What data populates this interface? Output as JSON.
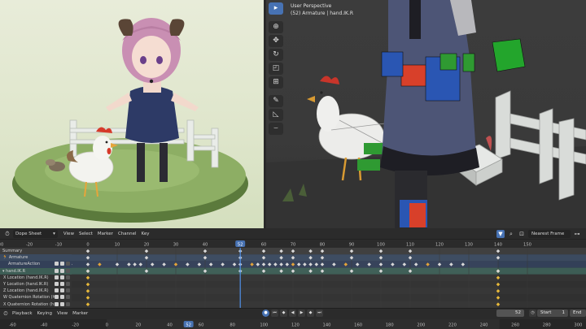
{
  "render_view": {
    "colors": {
      "ground": "#8dae64",
      "dress": "#2d3a66",
      "hair": "#c98fb3",
      "horns": "#5a4536",
      "fence": "#e9ece8"
    }
  },
  "viewport": {
    "title_line1": "User Perspective",
    "title_line2": "(52) Armature | hand.IK.R",
    "tools": [
      {
        "name": "select-box",
        "glyph": "▸",
        "active": true
      },
      {
        "name": "cursor",
        "glyph": "⊕",
        "active": false
      },
      {
        "name": "move",
        "glyph": "✥",
        "active": false
      },
      {
        "name": "rotate",
        "glyph": "↻",
        "active": false
      },
      {
        "name": "scale",
        "glyph": "◰",
        "active": false
      },
      {
        "name": "transform",
        "glyph": "⊞",
        "active": false
      },
      {
        "name": "annotate",
        "glyph": "✎",
        "active": false
      },
      {
        "name": "measure",
        "glyph": "◺",
        "active": false
      },
      {
        "name": "pose-tool",
        "glyph": "⌣",
        "active": false
      }
    ]
  },
  "dope_sheet": {
    "editor_label": "Dope Sheet",
    "menu": [
      "View",
      "Select",
      "Marker",
      "Channel",
      "Key"
    ],
    "interpolation": "Nearest Frame",
    "ruler_labels": [
      "-10",
      "0",
      "10",
      "20",
      "30",
      "40",
      "52",
      "60",
      "70",
      "80",
      "90",
      "100",
      "110",
      "120",
      "130",
      "140",
      "150"
    ],
    "ruler_start": -30,
    "ruler_end": 170,
    "extra_left_labels": [
      "-30",
      "-20"
    ],
    "current_frame": 52,
    "channels": [
      {
        "kind": "summary",
        "label": "Summary"
      },
      {
        "kind": "object",
        "label": "Armature"
      },
      {
        "kind": "action",
        "label": "ArmatureAction"
      },
      {
        "kind": "group",
        "label": "hand.IK.R"
      },
      {
        "kind": "fcurve",
        "label": "X Location (hand.IK.R)"
      },
      {
        "kind": "fcurve",
        "label": "Y Location (hand.IK.R)"
      },
      {
        "kind": "fcurve",
        "label": "Z Location (hand.IK.R)"
      },
      {
        "kind": "fcurve",
        "label": "W Quaternion Rotation (h"
      },
      {
        "kind": "fcurve",
        "label": "X Quaternion Rotation (h"
      }
    ],
    "keyframes_group": [
      0,
      140
    ],
    "keyframes_dense": [
      -10,
      -6,
      0,
      4,
      10,
      14,
      16,
      18,
      22,
      26,
      30,
      34,
      38,
      42,
      46,
      50,
      52,
      56,
      58,
      60,
      62,
      64,
      66,
      68,
      70,
      72,
      74,
      76,
      78,
      80,
      84,
      88,
      92,
      96,
      100,
      104,
      108,
      112,
      116,
      120,
      124,
      128
    ],
    "keyframes_sparse": [
      0,
      20,
      40,
      52,
      60,
      66,
      70,
      76,
      80,
      90,
      100,
      110,
      140
    ]
  },
  "timeline": {
    "menu": [
      "Playback",
      "Keying",
      "View",
      "Marker"
    ],
    "current_frame": "52",
    "start_label": "Start",
    "start_value": "1",
    "end_label": "End",
    "ruler_labels": [
      "-60",
      "-40",
      "-20",
      "0",
      "20",
      "40",
      "52",
      "60",
      "80",
      "100",
      "120",
      "140",
      "160",
      "180",
      "200",
      "220",
      "240",
      "260",
      "280",
      "300"
    ],
    "ruler_start": -68,
    "ruler_end": 305
  }
}
